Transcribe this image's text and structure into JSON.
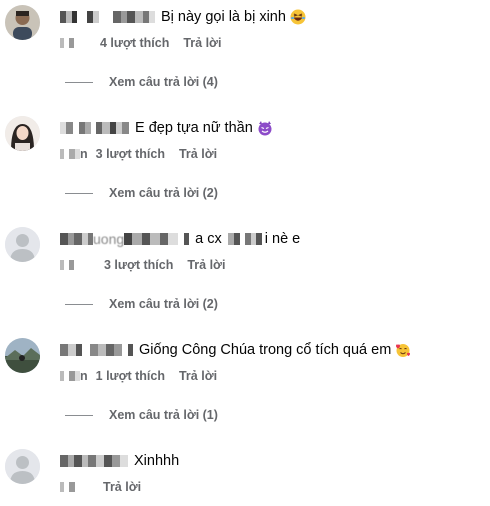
{
  "comments": [
    {
      "text": "Bị này gọi là bị xinh",
      "emoji": "laughing-face-icon",
      "likes": "4 lượt thích",
      "reply": "Trả lời",
      "view_replies": "Xem câu trả lời (4)",
      "avatar": "photo-avatar-man"
    },
    {
      "text": "E đẹp tựa nữ thần",
      "emoji": "purple-devil-face-icon",
      "time_suffix": "n",
      "likes": "3 lượt thích",
      "reply": "Trả lời",
      "view_replies": "Xem câu trả lời (2)",
      "avatar": "photo-avatar-woman"
    },
    {
      "text_prefix": "uong",
      "text": "a cx",
      "text_suffix": "i nè e",
      "likes": "3 lượt thích",
      "reply": "Trả lời",
      "view_replies": "Xem câu trả lời (2)",
      "avatar": "default-avatar"
    },
    {
      "text": "Giống Công Chúa trong cổ tích quá em",
      "emoji": "smiling-face-with-hearts-icon",
      "time_suffix": "n",
      "likes": "1 lượt thích",
      "reply": "Trả lời",
      "view_replies": "Xem câu trả lời (1)",
      "avatar": "photo-avatar-landscape"
    },
    {
      "text": "Xinhhh",
      "reply": "Trả lời",
      "avatar": "default-avatar"
    }
  ],
  "colors": {
    "secondary_text": "#65676b",
    "primary_text": "#050505",
    "pixelation": "#8f8f8f"
  }
}
